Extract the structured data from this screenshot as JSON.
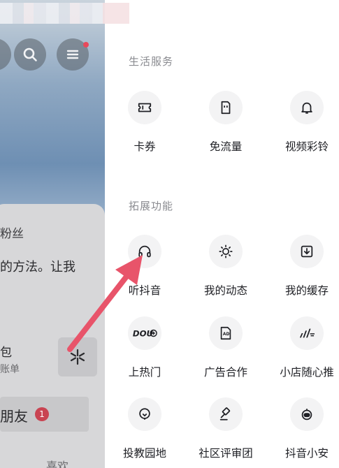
{
  "profile_behind": {
    "fans_label": "粉丝",
    "bio_snippet": "的方法。让我",
    "row_label": "包",
    "row_sub": "账单",
    "friends_label": "朋友",
    "friends_badge": "1",
    "likes_label": "喜欢"
  },
  "menu": {
    "sections": [
      {
        "title": "生活服务",
        "items": [
          {
            "label": "卡券",
            "icon": "ticket-icon"
          },
          {
            "label": "免流量",
            "icon": "sim-card-icon"
          },
          {
            "label": "视频彩铃",
            "icon": "bell-icon"
          }
        ]
      },
      {
        "title": "拓展功能",
        "items": [
          {
            "label": "听抖音",
            "icon": "headphones-icon"
          },
          {
            "label": "我的动态",
            "icon": "sun-icon"
          },
          {
            "label": "我的缓存",
            "icon": "download-box-icon"
          },
          {
            "label": "上热门",
            "icon": "dou-plus-icon"
          },
          {
            "label": "广告合作",
            "icon": "ad-icon"
          },
          {
            "label": "小店随心推",
            "icon": "speed-chart-icon"
          },
          {
            "label": "投教园地",
            "icon": "location-pin-icon"
          },
          {
            "label": "社区评审团",
            "icon": "gavel-icon"
          },
          {
            "label": "抖音小安",
            "icon": "robot-icon"
          }
        ]
      }
    ]
  },
  "annotation": {
    "color": "#e8546a",
    "target": "听抖音"
  }
}
